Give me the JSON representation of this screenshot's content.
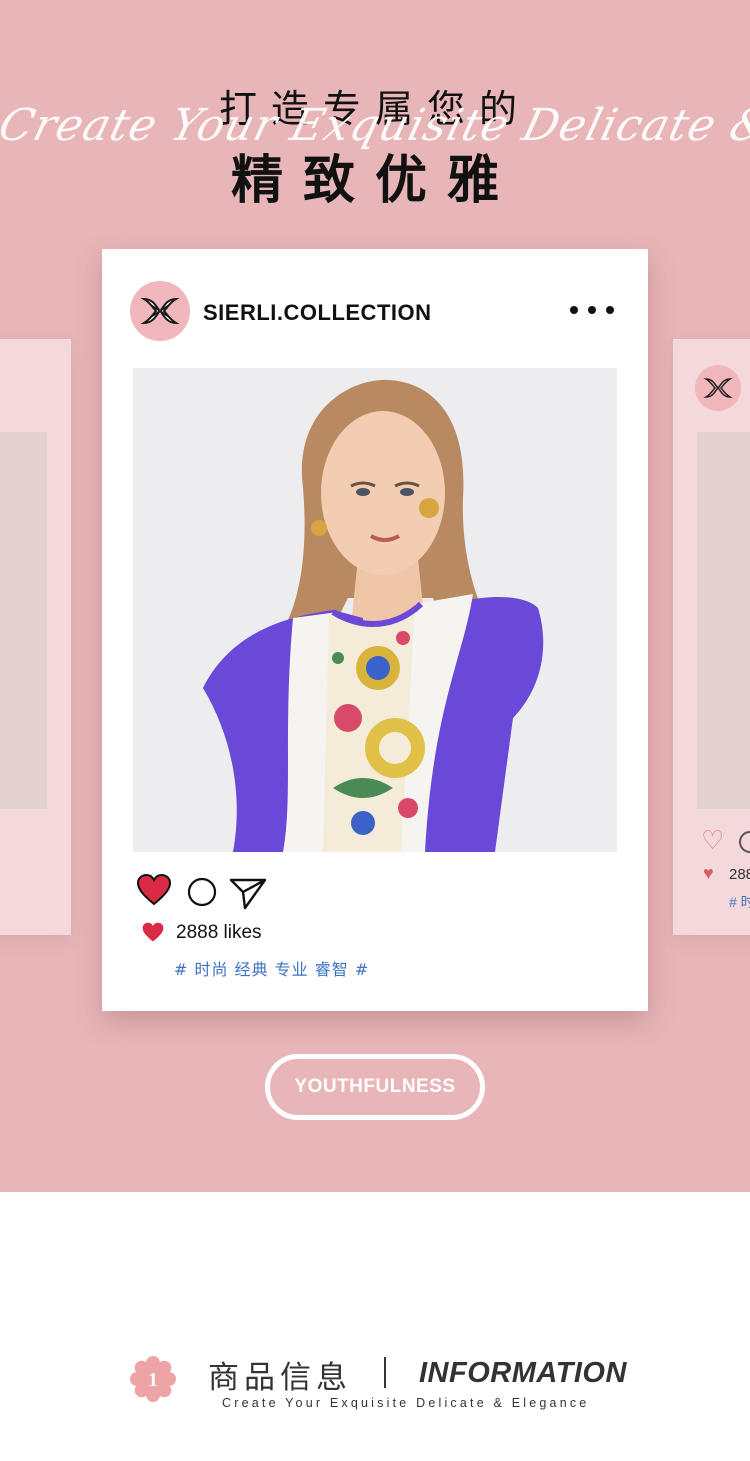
{
  "hero": {
    "title_line1": "打造专属您的",
    "script_text": "Create Your Exquisite Delicate & Elegance",
    "title_line2": "精致优雅",
    "background_color": "#e8b6b8"
  },
  "post": {
    "username": "SIERLI.COLLECTION",
    "likes": "2888 likes",
    "tags": "# 时尚 经典 专业 睿智 #",
    "tag_color": "#3d72c4",
    "heart_color": "#d92b45"
  },
  "ghost_right": {
    "likes": "288",
    "tags": "# 时"
  },
  "badge": {
    "label": "YOUTHFULNESS"
  },
  "info": {
    "number": "1",
    "title_cn": "商品信息",
    "title_en": "INFORMATION",
    "subtitle": "Create Your Exquisite Delicate & Elegance"
  }
}
